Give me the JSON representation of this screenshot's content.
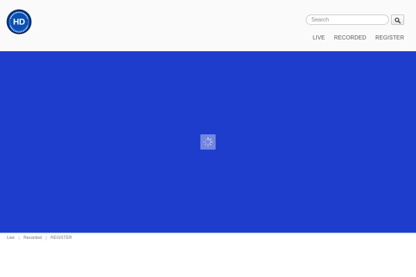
{
  "header": {
    "logo_text": "HD",
    "logo_ring_text": "ONLINE STREAM",
    "search": {
      "placeholder": "Search",
      "value": ""
    },
    "nav": [
      {
        "label": "LIVE"
      },
      {
        "label": "RECORDED"
      },
      {
        "label": "REGISTER"
      }
    ]
  },
  "player": {
    "background_color": "#1f3dcc",
    "state": "loading",
    "spinner_icon": "loading-spinner-icon"
  },
  "footer": {
    "links": [
      {
        "label": "Live"
      },
      {
        "label": "Recorded"
      },
      {
        "label": "REGISTER"
      }
    ]
  },
  "colors": {
    "brand_blue": "#1f3dcc",
    "logo_blue": "#0d63c9",
    "header_bg": "#fafafa"
  }
}
